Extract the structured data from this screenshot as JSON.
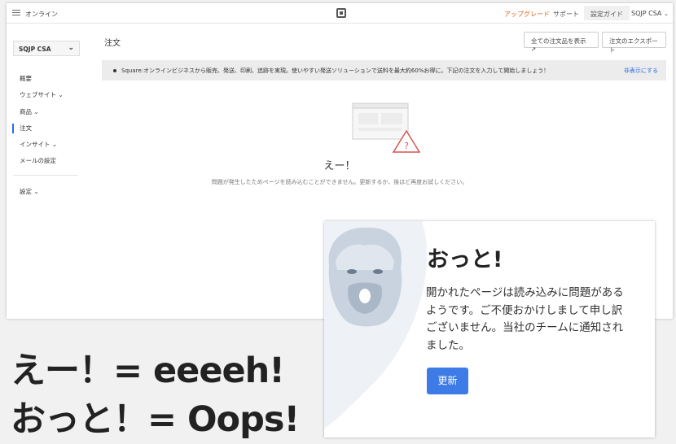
{
  "topbar": {
    "store_name": "オンライン",
    "upgrade": "アップグレード",
    "support": "サポート",
    "guide": "設定ガイド",
    "account": "SQJP CSA"
  },
  "sidebar": {
    "site_select": "SQJP CSA",
    "items": [
      {
        "label": "概要",
        "has_chevron": false
      },
      {
        "label": "ウェブサイト",
        "has_chevron": true
      },
      {
        "label": "商品",
        "has_chevron": true
      },
      {
        "label": "注文",
        "has_chevron": false,
        "active": true
      },
      {
        "label": "インサイト",
        "has_chevron": true
      },
      {
        "label": "メールの設定",
        "has_chevron": false
      }
    ],
    "settings": "設定"
  },
  "main": {
    "title": "注文",
    "view_all_button": "全ての注文品を表示",
    "export_button": "注文のエクスポート",
    "banner_message": "Square:オンラインビジネスから販売、発送、印刷、追跡を実現。使いやすい発送ソリューションで送料を最大約60%お得に。下記の注文を入力して開始しましょう！",
    "banner_hide": "非表示にする",
    "error_title": "えー！",
    "error_description": "問題が発生したためページを読み込むことができません。更新するか、後ほど再度お試しください。",
    "error_icon": "warning-icon"
  },
  "card": {
    "title": "おっと!",
    "message_lines": [
      "開かれたページは読み込みに問題がある",
      "ようです。ご不便おかけしまして申し訳",
      "ございません。当社のチームに通知され",
      "ました。"
    ],
    "refresh_button": "更新",
    "illustration": "bearded-face-illustration"
  },
  "captions": {
    "line1": "えー！= eeeeh!",
    "line2": "おっと！= Oops!"
  },
  "colors": {
    "accent": "#2b6de0",
    "upgrade": "#e0601a",
    "button": "#3d7be6",
    "warning": "#d9534f"
  }
}
